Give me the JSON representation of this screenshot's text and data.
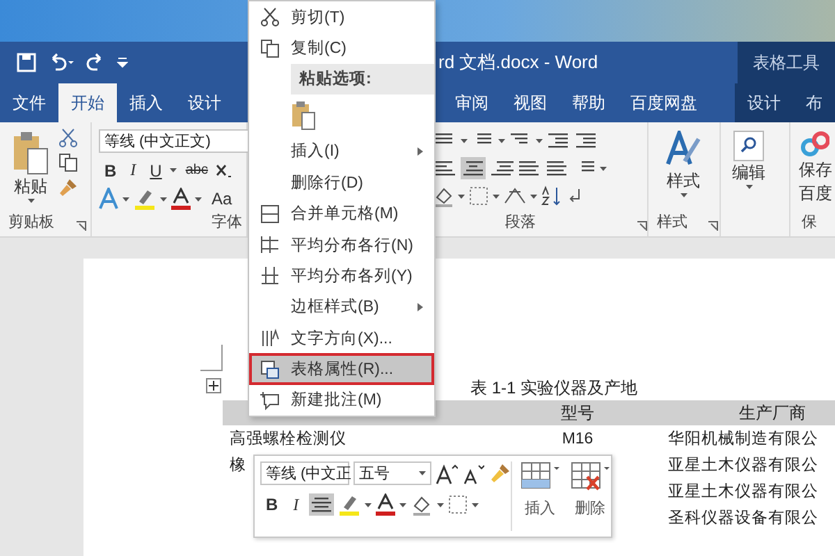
{
  "title_bar": {
    "title": "rd 文档.docx - Word",
    "contextual_label": "表格工具"
  },
  "tabs": [
    {
      "label": "文件",
      "selected": false,
      "contextual": false
    },
    {
      "label": "开始",
      "selected": true,
      "contextual": false
    },
    {
      "label": "插入",
      "selected": false,
      "contextual": false
    },
    {
      "label": "设计",
      "selected": false,
      "contextual": false
    },
    {
      "label": "审阅",
      "selected": false,
      "contextual": false
    },
    {
      "label": "视图",
      "selected": false,
      "contextual": false
    },
    {
      "label": "帮助",
      "selected": false,
      "contextual": false
    },
    {
      "label": "百度网盘",
      "selected": false,
      "contextual": false
    },
    {
      "label": "设计",
      "selected": false,
      "contextual": true
    },
    {
      "label": "布",
      "selected": false,
      "contextual": true
    }
  ],
  "ribbon": {
    "clipboard": {
      "paste_label": "粘贴",
      "group_label": "剪贴板"
    },
    "font": {
      "font_name": "等线 (中文正文)",
      "text_buttons": [
        "B",
        "I",
        "U",
        "abc"
      ],
      "case_label": "Aa",
      "group_label": "字体"
    },
    "paragraph": {
      "alignments": [
        {
          "selected": false
        },
        {
          "selected": true
        },
        {
          "selected": false
        },
        {
          "selected": false
        },
        {
          "selected": false
        }
      ],
      "group_label": "段落"
    },
    "styles": {
      "button_label": "样式",
      "group_label": "样式"
    },
    "editing": {
      "button_label": "编辑"
    },
    "save": {
      "button_lines": [
        "保存",
        "百度"
      ],
      "group_label": "保"
    }
  },
  "context_menu": [
    {
      "kind": "item",
      "label": "剪切(T)",
      "selected": false
    },
    {
      "kind": "item",
      "label": "复制(C)",
      "selected": false
    },
    {
      "kind": "header",
      "label": "粘贴选项:",
      "selected": false
    },
    {
      "kind": "paste",
      "selected": false
    },
    {
      "kind": "submenu",
      "label": "插入(I)",
      "selected": false
    },
    {
      "kind": "item",
      "label": "删除行(D)",
      "selected": false
    },
    {
      "kind": "item",
      "label": "合并单元格(M)",
      "selected": false
    },
    {
      "kind": "item",
      "label": "平均分布各行(N)",
      "selected": false
    },
    {
      "kind": "item",
      "label": "平均分布各列(Y)",
      "selected": false
    },
    {
      "kind": "submenu",
      "label": "边框样式(B)",
      "selected": false
    },
    {
      "kind": "item",
      "label": "文字方向(X)...",
      "selected": false
    },
    {
      "kind": "item",
      "label": "表格属性(R)...",
      "selected": true
    },
    {
      "kind": "item",
      "label": "新建批注(M)",
      "selected": false
    }
  ],
  "document": {
    "caption": "表 1-1 实验仪器及产地",
    "headers": [
      "型号",
      "生产厂商"
    ],
    "rows": [
      {
        "name": "高强螺栓检测仪",
        "model": "M16",
        "maker": "华阳机械制造有限公"
      },
      {
        "name": "橡",
        "maker": "亚星土木仪器有限公"
      },
      {
        "maker": "亚星土木仪器有限公"
      },
      {
        "maker": "圣科仪器设备有限公"
      }
    ]
  },
  "mini_toolbar": {
    "font_name": "等线 (中文正",
    "font_size": "五号",
    "text_buttons": [
      "B",
      "I"
    ],
    "align_selected": true,
    "table_buttons": [
      "插入",
      "删除"
    ]
  }
}
